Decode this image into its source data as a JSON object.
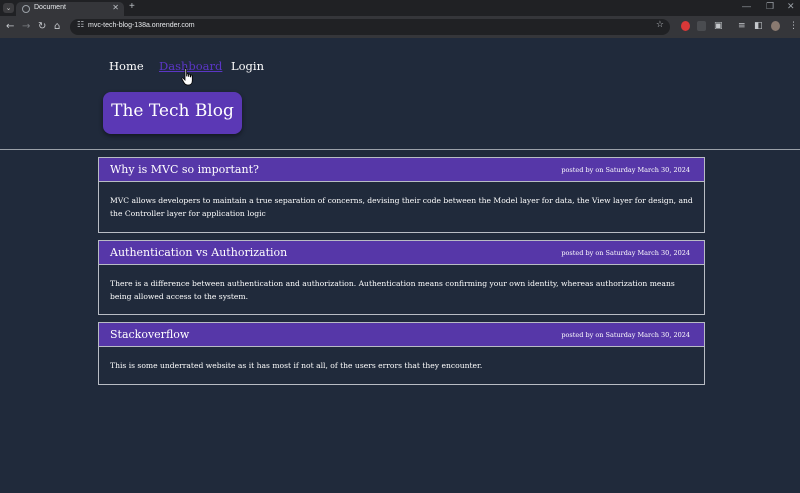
{
  "browser": {
    "tab_menu_glyph": "⌄",
    "tab_title": "Document",
    "tab_close": "✕",
    "new_tab": "+",
    "window_minimize": "—",
    "window_restore": "❐",
    "window_close": "✕",
    "back": "←",
    "forward": "→",
    "reload": "↻",
    "home": "⌂",
    "site_info": "☷",
    "url": "mvc-tech-blog-138a.onrender.com",
    "bookmark": "☆"
  },
  "nav": {
    "home": "Home",
    "dashboard": "Dashboard",
    "login": "Login"
  },
  "site": {
    "title": "The Tech Blog"
  },
  "posts": [
    {
      "title": "Why is MVC so important?",
      "meta": "posted by on Saturday March 30, 2024",
      "body": "MVC allows developers to maintain a true separation of concerns, devising their code between the Model layer for data, the View layer for design, and the Controller layer for application logic"
    },
    {
      "title": "Authentication vs Authorization",
      "meta": "posted by on Saturday March 30, 2024",
      "body": "There is a difference between authentication and authorization. Authentication means confirming your own identity, whereas authorization means being allowed access to the system."
    },
    {
      "title": "Stackoverflow",
      "meta": "posted by on Saturday March 30, 2024",
      "body": "This is some underrated website as it has most if not all, of the users errors that they encounter."
    }
  ],
  "colors": {
    "page_bg": "#202a3b",
    "accent": "#5b38b5",
    "card_header": "#5637a8",
    "nav_active": "#5b36c6"
  }
}
